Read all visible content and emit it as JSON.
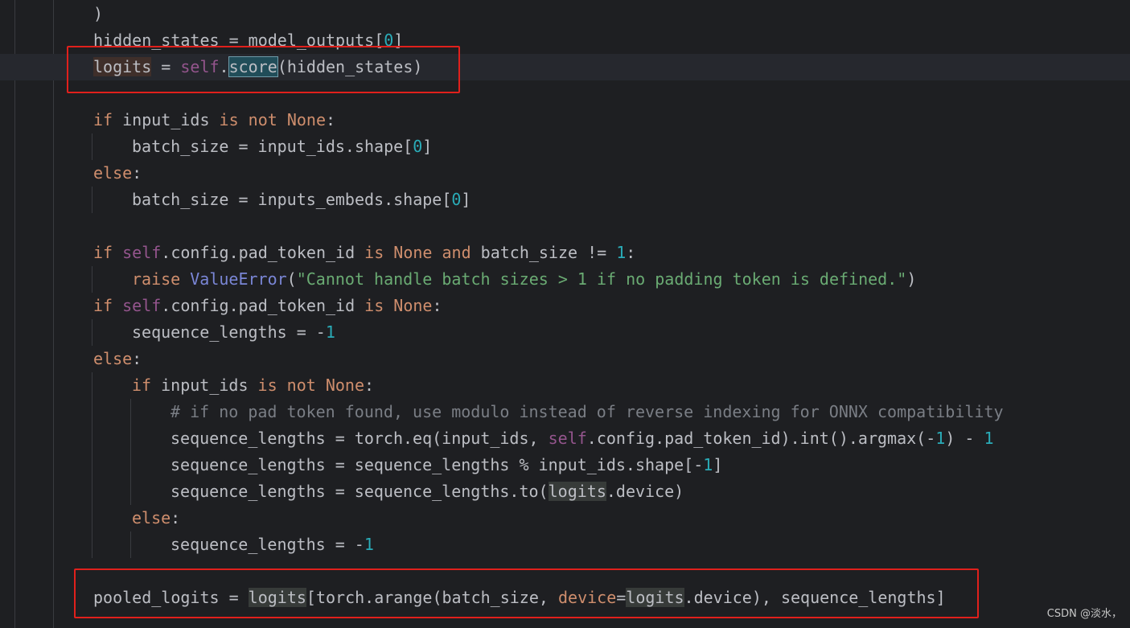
{
  "editor": {
    "lines": {
      "l1": ")",
      "l2_a": "hidden_states = model_outputs[",
      "l2_b": "0",
      "l2_c": "]",
      "l3_a": "logits",
      "l3_b": " = ",
      "l3_c": "self",
      "l3_d": ".",
      "l3_e": "score",
      "l3_f": "(hidden_states)",
      "l5_a": "if",
      "l5_b": " input_ids ",
      "l5_c": "is not None",
      "l5_d": ":",
      "l6_a": "batch_size = input_ids.shape[",
      "l6_b": "0",
      "l6_c": "]",
      "l7_a": "else",
      "l7_b": ":",
      "l8_a": "batch_size = inputs_embeds.shape[",
      "l8_b": "0",
      "l8_c": "]",
      "l10_a": "if ",
      "l10_b": "self",
      "l10_c": ".config.pad_token_id ",
      "l10_d": "is None and",
      "l10_e": " batch_size != ",
      "l10_f": "1",
      "l10_g": ":",
      "l11_a": "raise ",
      "l11_b": "ValueError",
      "l11_c": "(",
      "l11_d": "\"Cannot handle batch sizes > 1 if no padding token is defined.\"",
      "l11_e": ")",
      "l12_a": "if ",
      "l12_b": "self",
      "l12_c": ".config.pad_token_id ",
      "l12_d": "is None",
      "l12_e": ":",
      "l13_a": "sequence_lengths = -",
      "l13_b": "1",
      "l14_a": "else",
      "l14_b": ":",
      "l15_a": "if",
      "l15_b": " input_ids ",
      "l15_c": "is not None",
      "l15_d": ":",
      "l16": "# if no pad token found, use modulo instead of reverse indexing for ONNX compatibility",
      "l17_a": "sequence_lengths = torch.eq(input_ids, ",
      "l17_b": "self",
      "l17_c": ".config.pad_token_id).int().argmax(-",
      "l17_d": "1",
      "l17_e": ") - ",
      "l17_f": "1",
      "l18_a": "sequence_lengths = sequence_lengths % input_ids.shape[-",
      "l18_b": "1",
      "l18_c": "]",
      "l19_a": "sequence_lengths = sequence_lengths.to(",
      "l19_b": "logits",
      "l19_c": ".device)",
      "l20_a": "else",
      "l20_b": ":",
      "l21_a": "sequence_lengths = -",
      "l21_b": "1",
      "l23_a": "pooled_logits = ",
      "l23_b": "logits",
      "l23_c": "[torch.arange(batch_size, ",
      "l23_d": "device",
      "l23_e": "=",
      "l23_f": "logits",
      "l23_g": ".device), sequence_lengths]"
    }
  },
  "watermark": "CSDN @淡水，",
  "colors": {
    "background": "#1e1f22",
    "keyword": "#cf8e6d",
    "self": "#94558d",
    "number": "#2aacb8",
    "string": "#6aab73",
    "comment": "#7a7e85",
    "annotation_box": "#e0201c"
  }
}
